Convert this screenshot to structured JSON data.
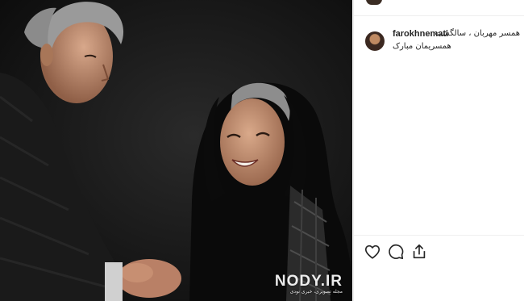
{
  "post": {
    "username": "farokhnemati",
    "caption_line1": "همسر مهربان ، سالگشت",
    "caption_line2": "همسریمان مبارک"
  },
  "icons": {
    "like": "heart-icon",
    "comment": "comment-icon",
    "share": "share-icon"
  },
  "watermark": {
    "brand": "NODY.IR",
    "tagline": "مجله تصویری، خبری نودی"
  },
  "colors": {
    "text": "#262626",
    "photo_background": "#121212",
    "divider": "#efefef"
  }
}
